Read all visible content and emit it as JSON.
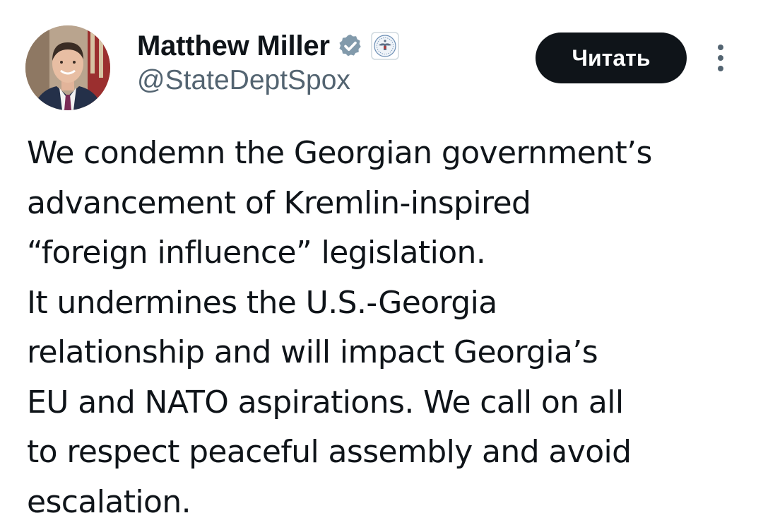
{
  "author": {
    "display_name": "Matthew Miller",
    "handle": "@StateDeptSpox",
    "verified_icon": "verified-badge-icon",
    "affiliation_icon": "state-department-seal-icon"
  },
  "actions": {
    "follow_label": "Читать",
    "more_icon": "more-vertical-icon"
  },
  "tweet": {
    "lines": [
      "We condemn the Georgian government’s",
      "advancement of Kremlin-inspired",
      "“foreign influence” legislation.",
      "It undermines the U.S.-Georgia",
      "relationship and will impact Georgia’s",
      "EU and NATO aspirations. We call on all",
      "to respect peaceful assembly and avoid",
      "escalation."
    ]
  },
  "colors": {
    "text_primary": "#0f1419",
    "text_secondary": "#536471",
    "button_bg": "#0f1419",
    "button_text": "#ffffff",
    "verified_badge": "#829aab"
  }
}
